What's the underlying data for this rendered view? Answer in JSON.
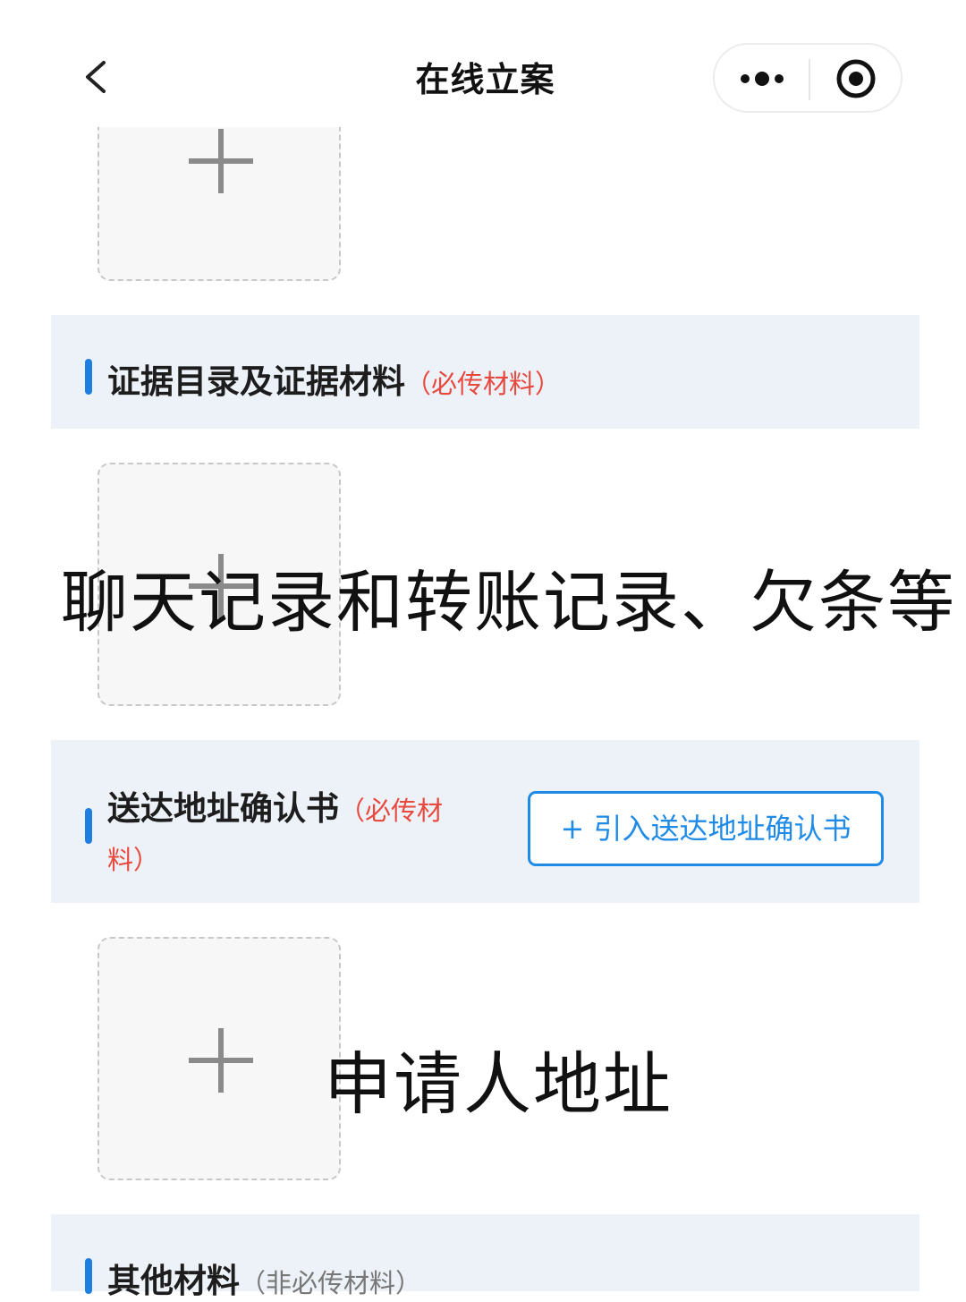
{
  "header": {
    "title": "在线立案",
    "back_icon": "chevron-left-icon",
    "more_icon": "more-dots-icon",
    "close_icon": "target-circle-icon"
  },
  "sections": [
    {
      "title": "证据目录及证据材料",
      "note": "（必传材料）"
    },
    {
      "title_line1": "送达地址确认书",
      "note_line1": "（必传材",
      "note_line2": "料）",
      "import_button": "+ 引入送达地址确认书"
    },
    {
      "title": "其他材料",
      "note": "（非必传材料）"
    }
  ],
  "overlay": {
    "evidence_note": "聊天记录和转账记录、欠条等",
    "address_note": "申请人地址"
  },
  "colors": {
    "accent": "#1f7fe0",
    "required_note": "#e8493f",
    "section_bg": "#edf2f8",
    "upload_bg": "#f7f7f8"
  }
}
